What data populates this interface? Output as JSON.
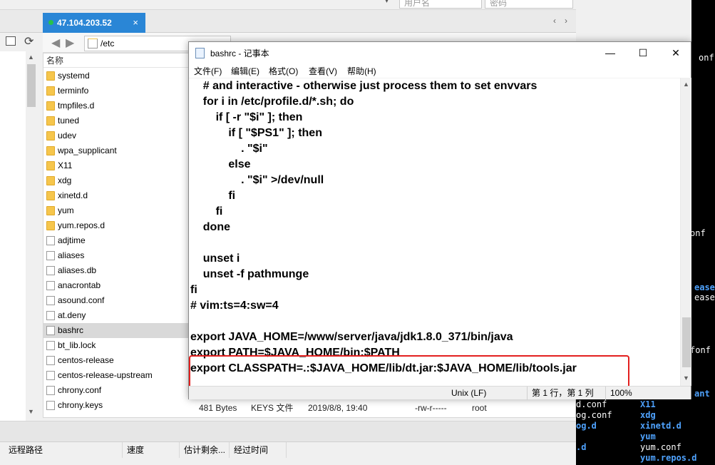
{
  "top_strip": {
    "user_placeholder": "用户名",
    "password_placeholder": "密码"
  },
  "session_tab": {
    "label": "47.104.203.52",
    "close": "×"
  },
  "path_bar": {
    "path": "/etc"
  },
  "file_list": {
    "column_name": "名称",
    "items": [
      {
        "name": "systemd",
        "type": "folder"
      },
      {
        "name": "terminfo",
        "type": "folder"
      },
      {
        "name": "tmpfiles.d",
        "type": "folder"
      },
      {
        "name": "tuned",
        "type": "folder"
      },
      {
        "name": "udev",
        "type": "folder"
      },
      {
        "name": "wpa_supplicant",
        "type": "folder"
      },
      {
        "name": "X11",
        "type": "folder"
      },
      {
        "name": "xdg",
        "type": "folder"
      },
      {
        "name": "xinetd.d",
        "type": "folder"
      },
      {
        "name": "yum",
        "type": "folder"
      },
      {
        "name": "yum.repos.d",
        "type": "folder"
      },
      {
        "name": "adjtime",
        "type": "file"
      },
      {
        "name": "aliases",
        "type": "file"
      },
      {
        "name": "aliases.db",
        "type": "file"
      },
      {
        "name": "anacrontab",
        "type": "file"
      },
      {
        "name": "asound.conf",
        "type": "file"
      },
      {
        "name": "at.deny",
        "type": "file"
      },
      {
        "name": "bashrc",
        "type": "file",
        "selected": true
      },
      {
        "name": "bt_lib.lock",
        "type": "file"
      },
      {
        "name": "centos-release",
        "type": "file"
      },
      {
        "name": "centos-release-upstream",
        "type": "file"
      },
      {
        "name": "chrony.conf",
        "type": "file"
      },
      {
        "name": "chrony.keys",
        "type": "file"
      }
    ],
    "chrony_keys_details": {
      "size": "481 Bytes",
      "type": "KEYS 文件",
      "modified": "2019/8/8, 19:40",
      "perms": "-rw-r-----",
      "owner": "root"
    }
  },
  "transfer_header": {
    "remote_path": "远程路径",
    "speed": "速度",
    "eta": "估计剩余...",
    "elapsed": "经过时间"
  },
  "terminal": {
    "lines": [
      {
        "text": "onf",
        "color": "#ffffff"
      },
      {
        "text": "fonf",
        "color": "#ffffff"
      },
      {
        "text": "onf",
        "color": "#ffffff"
      },
      {
        "text": "ease",
        "color": "#4fa3ff"
      },
      {
        "text": "ease-u",
        "color": "#ffffff"
      },
      {
        "text": "ant",
        "color": "#4fa3ff"
      },
      {
        "text": "d.conf",
        "color": "#ffffff"
      },
      {
        "text": "X11",
        "color": "#4fa3ff"
      },
      {
        "text": "og.conf",
        "color": "#ffffff"
      },
      {
        "text": "xdg",
        "color": "#4fa3ff"
      },
      {
        "text": "og.d",
        "color": "#4fa3ff"
      },
      {
        "text": "xinetd.d",
        "color": "#4fa3ff"
      },
      {
        "text": "yum",
        "color": "#4fa3ff"
      },
      {
        "text": ".d",
        "color": "#4fa3ff"
      },
      {
        "text": "yum.conf",
        "color": "#ffffff"
      },
      {
        "text": "yum.repos.d",
        "color": "#4fa3ff"
      }
    ]
  },
  "notepad": {
    "title": "bashrc - 记事本",
    "menu": [
      "文件(F)",
      "编辑(E)",
      "格式(O)",
      "查看(V)",
      "帮助(H)"
    ],
    "controls": {
      "minimize": "—",
      "maximize": "☐",
      "close": "✕"
    },
    "code_lines": [
      "    # and interactive - otherwise just process them to set envvars",
      "    for i in /etc/profile.d/*.sh; do",
      "        if [ -r \"$i\" ]; then",
      "            if [ \"$PS1\" ]; then",
      "                . \"$i\"",
      "            else",
      "                . \"$i\" >/dev/null",
      "            fi",
      "        fi",
      "    done",
      "",
      "    unset i",
      "    unset -f pathmunge",
      "fi",
      "# vim:ts=4:sw=4",
      "",
      "export JAVA_HOME=/www/server/java/jdk1.8.0_371/bin/java",
      "export PATH=$JAVA_HOME/bin:$PATH",
      "export CLASSPATH=.:$JAVA_HOME/lib/dt.jar:$JAVA_HOME/lib/tools.jar"
    ],
    "status": {
      "line_ending": "Unix (LF)",
      "position": "第 1 行，第 1 列",
      "zoom": "100%"
    }
  }
}
